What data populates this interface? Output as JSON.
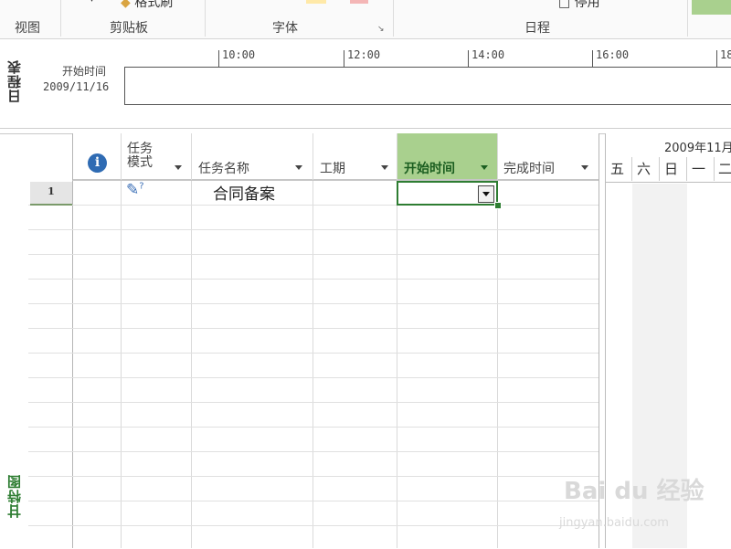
{
  "ribbon": {
    "top_partial_text": "格式刷",
    "top_partial_text_right": "停用",
    "groups": [
      {
        "label": "视图"
      },
      {
        "label": "剪贴板"
      },
      {
        "label": "字体"
      },
      {
        "label": "日程"
      }
    ],
    "swatch_colors": [
      "#ffe9a8",
      "#f4b6b6"
    ],
    "accent_green": "#a9d08e"
  },
  "timeline": {
    "side_label": "日程表",
    "start_label": "开始时间",
    "start_date": "2009/11/16",
    "times": [
      "10:00",
      "12:00",
      "14:00",
      "16:00",
      "18"
    ]
  },
  "table": {
    "side_label": "甘特图",
    "columns": [
      {
        "label": "",
        "icon": "info-icon"
      },
      {
        "label_line1": "任务",
        "label_line2": "模式"
      },
      {
        "label": "任务名称"
      },
      {
        "label": "工期"
      },
      {
        "label": "开始时间",
        "selected": true
      },
      {
        "label": "完成时间"
      }
    ],
    "rows": [
      {
        "num": "1",
        "mode_icon": "manual-schedule-icon",
        "name": "合同备案",
        "duration": "",
        "start": "",
        "finish": ""
      }
    ]
  },
  "chart": {
    "month": "2009年11月",
    "days": [
      "五",
      "六",
      "日",
      "一",
      "二"
    ]
  },
  "watermark": {
    "main": "Bai du 经验",
    "sub": "jingyan.baidu.com"
  }
}
